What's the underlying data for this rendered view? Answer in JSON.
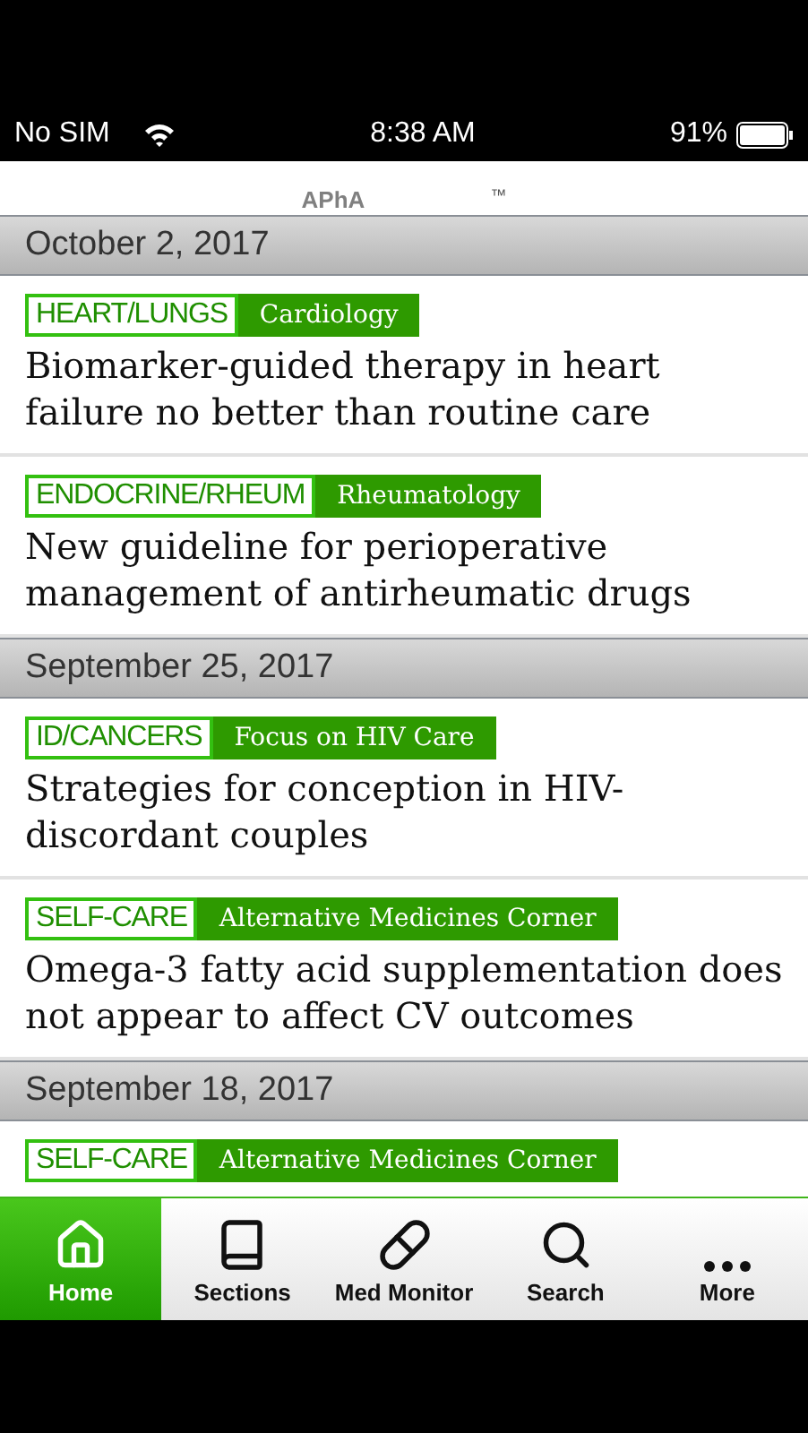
{
  "status_bar": {
    "carrier": "No SIM",
    "time": "8:38 AM",
    "battery": "91%"
  },
  "header": {
    "logo": "APhA",
    "trademark": "™"
  },
  "sections": [
    {
      "date": "October 2, 2017",
      "articles": [
        {
          "category": "HEART/LUNGS",
          "section": "Cardiology",
          "title": "Biomarker-guided therapy in heart failure no better than routine care"
        },
        {
          "category": "ENDOCRINE/RHEUM",
          "section": "Rheumatology",
          "title": "New guideline for perioperative management of antirheumatic drugs"
        }
      ]
    },
    {
      "date": "September 25, 2017",
      "articles": [
        {
          "category": "ID/CANCERS",
          "section": "Focus on HIV Care",
          "title": "Strategies for conception in HIV-discordant couples"
        },
        {
          "category": "SELF-CARE",
          "section": "Alternative Medicines Corner",
          "title": "Omega-3 fatty acid supplementation does not appear to affect CV outcomes"
        }
      ]
    },
    {
      "date": "September 18, 2017",
      "articles": [
        {
          "category": "SELF-CARE",
          "section": "Alternative Medicines Corner"
        }
      ]
    }
  ],
  "tabs": [
    {
      "kind": "home",
      "label": "Home",
      "selected": true
    },
    {
      "kind": "sections",
      "label": "Sections",
      "selected": false
    },
    {
      "kind": "pills",
      "label": "Med Monitor",
      "selected": false
    },
    {
      "kind": "search",
      "label": "Search",
      "selected": false
    },
    {
      "kind": "more",
      "label": "More",
      "selected": false
    }
  ]
}
